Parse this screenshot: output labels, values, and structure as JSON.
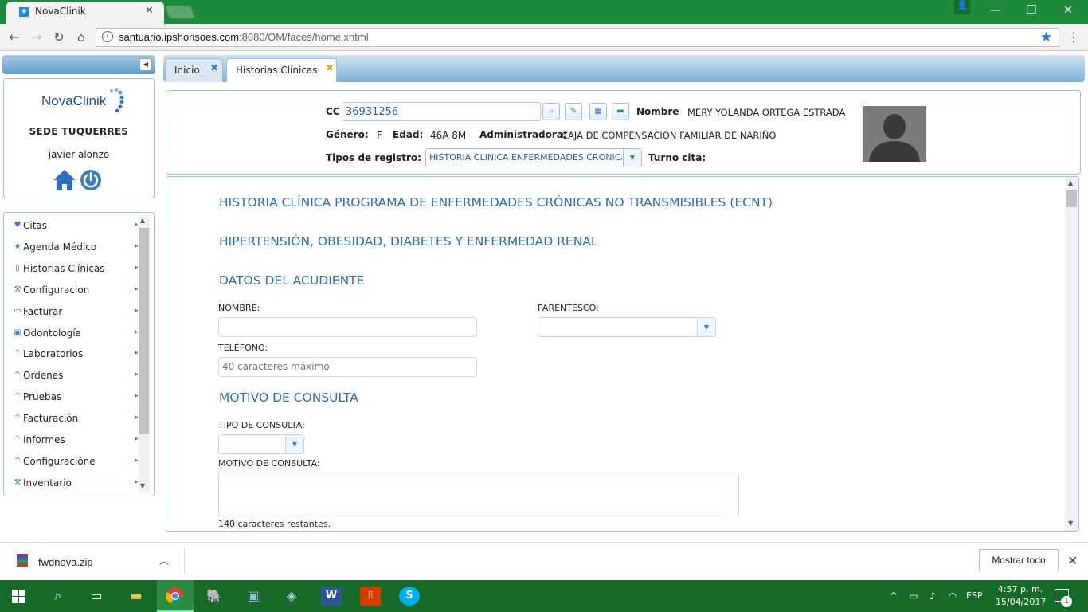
{
  "browser": {
    "tab_title": "NovaClinik",
    "tab_favicon": "+",
    "url_host": "santuario.ipshorisoes.com",
    "url_rest": ":8080/OM/faces/home.xhtml"
  },
  "app": {
    "tabs": [
      {
        "label": "Inicio"
      },
      {
        "label": "Historias Clínicas"
      }
    ],
    "logo": "NovaClinik",
    "sede": "SEDE TUQUERRES",
    "user": "javier alonzo"
  },
  "menu": [
    {
      "icon": "heart-icon",
      "glyph": "♥",
      "label": "Citas"
    },
    {
      "icon": "star-icon",
      "glyph": "★",
      "label": "Agenda Médico"
    },
    {
      "icon": "clipboard-icon",
      "glyph": "▯",
      "label": "Historias Clínicas"
    },
    {
      "icon": "wrench-icon",
      "glyph": "⚒",
      "label": "Configuracion"
    },
    {
      "icon": "printer-icon",
      "glyph": "▭",
      "label": "Facturar"
    },
    {
      "icon": "tooth-icon",
      "glyph": "▣",
      "label": "Odontología"
    },
    {
      "icon": "caret-up-icon",
      "glyph": "^",
      "label": "Laboratorios"
    },
    {
      "icon": "caret-up-icon",
      "glyph": "^",
      "label": "Ordenes"
    },
    {
      "icon": "caret-up-icon",
      "glyph": "^",
      "label": "Pruebas"
    },
    {
      "icon": "caret-up-icon",
      "glyph": "^",
      "label": "Facturación"
    },
    {
      "icon": "caret-up-icon",
      "glyph": "^",
      "label": "Informes"
    },
    {
      "icon": "caret-up-icon",
      "glyph": "^",
      "label": "Configuraciône"
    },
    {
      "icon": "wrench-icon",
      "glyph": "⚒",
      "label": "Inventario"
    }
  ],
  "patient": {
    "cc_label": "CC",
    "cc_value": "36931256",
    "nombre_label": "Nombre",
    "nombre_value": "MERY YOLANDA ORTEGA ESTRADA",
    "genero_label": "Género:",
    "genero_value": "F",
    "edad_label": "Edad:",
    "edad_value": "46A 8M",
    "admin_label": "Administradora:",
    "admin_value": "CAJA DE COMPENSACION FAMILIAR DE NARIÑO",
    "tipos_label": "Tipos de registro:",
    "tipos_value": "HISTORIA CLINICA ENFERMEDADES CRONICAS",
    "turno_label": "Turno cita:"
  },
  "form": {
    "title1": "HISTORIA CLÍNICA PROGRAMA DE ENFERMEDADES CRÓNICAS NO TRANSMISIBLES (ECNT)",
    "title2": "HIPERTENSIÓN, OBESIDAD, DIABETES Y ENFERMEDAD RENAL",
    "section_acudiente": "DATOS DEL ACUDIENTE",
    "nombre_label": "NOMBRE:",
    "nombre_value": "",
    "parentesco_label": "PARENTESCO:",
    "telefono_label": "TELÉFONO:",
    "telefono_placeholder": "40 caracteres máximo",
    "section_motivo": "MOTIVO DE CONSULTA",
    "tipo_consulta_label": "TIPO DE CONSULTA:",
    "motivo_label": "MOTIVO DE CONSULTA:",
    "motivo_value": "",
    "chars_left": "140 caracteres restantes."
  },
  "downloads": {
    "file": "fwdnova.zip",
    "show_all": "Mostrar todo"
  },
  "taskbar": {
    "lang": "ESP",
    "time": "4:57 p. m.",
    "date": "15/04/2017",
    "notifications": "1"
  },
  "colors": {
    "accent": "#2c6db5",
    "chrome_frame": "#1e8b3b",
    "taskbar": "#176b28",
    "panel_border": "#9cc3e5"
  }
}
